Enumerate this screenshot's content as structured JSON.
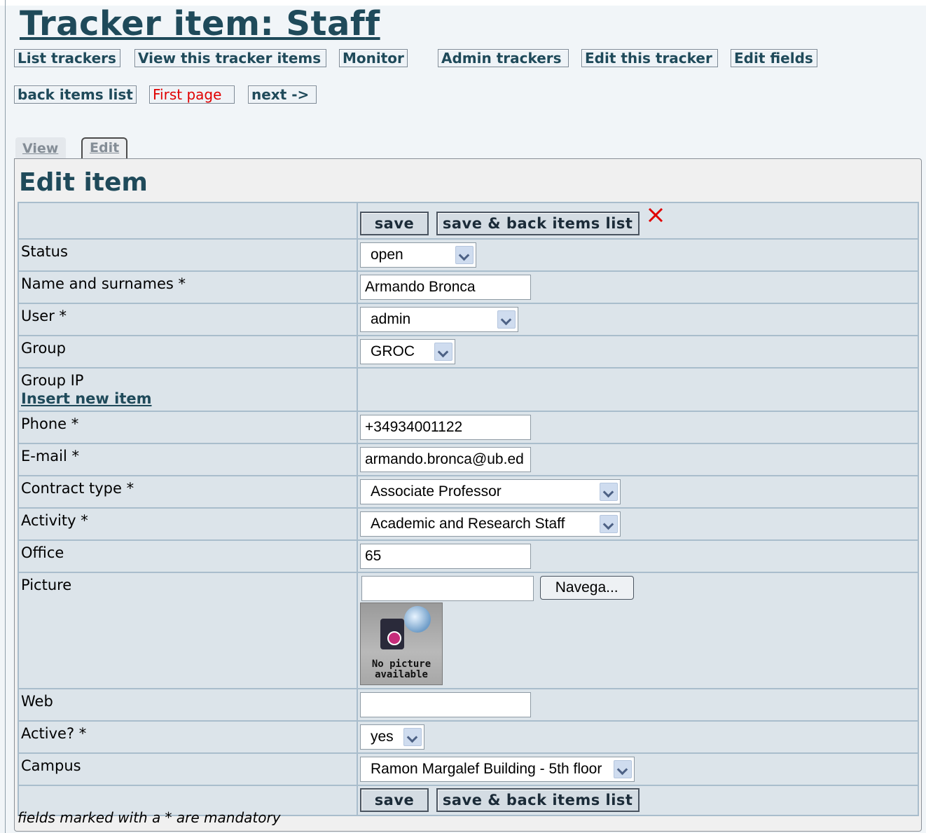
{
  "header": {
    "title": "Tracker item: Staff",
    "nav": [
      "List trackers",
      "View this tracker items",
      "Monitor",
      "Admin trackers",
      "Edit this tracker",
      "Edit fields"
    ],
    "nav2": [
      "back items list",
      "First page",
      "next ->"
    ]
  },
  "tabs": {
    "view": "View",
    "edit": "Edit"
  },
  "panel": {
    "heading": "Edit item"
  },
  "buttons": {
    "save": "save",
    "save_back": "save & back items list",
    "browse": "Navega..."
  },
  "fields": {
    "status": {
      "label": "Status",
      "value": "open"
    },
    "name": {
      "label": "Name and surnames *",
      "value": "Armando Bronca"
    },
    "user": {
      "label": "User *",
      "value": "admin"
    },
    "group": {
      "label": "Group",
      "value": "GROC"
    },
    "group_ip": {
      "label": "Group IP",
      "link": "Insert new item"
    },
    "phone": {
      "label": "Phone *",
      "value": "+34934001122"
    },
    "email": {
      "label": "E-mail *",
      "value": "armando.bronca@ub.ed"
    },
    "contract": {
      "label": "Contract type *",
      "value": "Associate Professor"
    },
    "activity": {
      "label": "Activity *",
      "value": "Academic and Research Staff"
    },
    "office": {
      "label": "Office",
      "value": "65"
    },
    "picture": {
      "label": "Picture",
      "value": "",
      "placeholder_caption_1": "No picture",
      "placeholder_caption_2": "available"
    },
    "web": {
      "label": "Web",
      "value": ""
    },
    "active": {
      "label": "Active? *",
      "value": "yes"
    },
    "campus": {
      "label": "Campus",
      "value": "Ramon Margalef Building - 5th floor"
    }
  },
  "footnote": "fields marked with a * are mandatory",
  "colors": {
    "heading": "#1f4a5a",
    "first_page": "#e00000",
    "delete_x": "#e00000"
  }
}
